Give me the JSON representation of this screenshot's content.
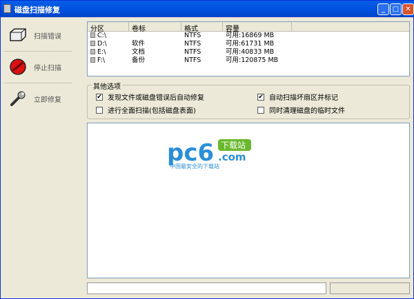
{
  "window": {
    "title": "磁盘扫描修复"
  },
  "sidebar": {
    "items": [
      {
        "label": "扫描错误"
      },
      {
        "label": "停止扫描"
      },
      {
        "label": "立即修复"
      }
    ]
  },
  "drives": {
    "columns": [
      "分区",
      "卷标",
      "格式",
      "容量"
    ],
    "rows": [
      {
        "partition": "C:\\",
        "label": "",
        "format": "NTFS",
        "capacity": "可用:16869 MB"
      },
      {
        "partition": "D:\\",
        "label": "软件",
        "format": "NTFS",
        "capacity": "可用:61731 MB"
      },
      {
        "partition": "E:\\",
        "label": "文档",
        "format": "NTFS",
        "capacity": "可用:40833 MB"
      },
      {
        "partition": "F:\\",
        "label": "备份",
        "format": "NTFS",
        "capacity": "可用:120875 MB"
      }
    ]
  },
  "options": {
    "legend": "其他选项",
    "items": [
      {
        "label": "发现文件或磁盘错误后自动修复",
        "checked": true
      },
      {
        "label": "进行全面扫描(包括磁盘表面)",
        "checked": false
      },
      {
        "label": "自动扫描坏扇区并标记",
        "checked": true
      },
      {
        "label": "同时清理磁盘的临时文件",
        "checked": false
      }
    ]
  },
  "watermark": {
    "brand": "pc6",
    "sub": "下载站",
    ".com": ".com",
    "tagline": "中国最安全的下载站"
  }
}
